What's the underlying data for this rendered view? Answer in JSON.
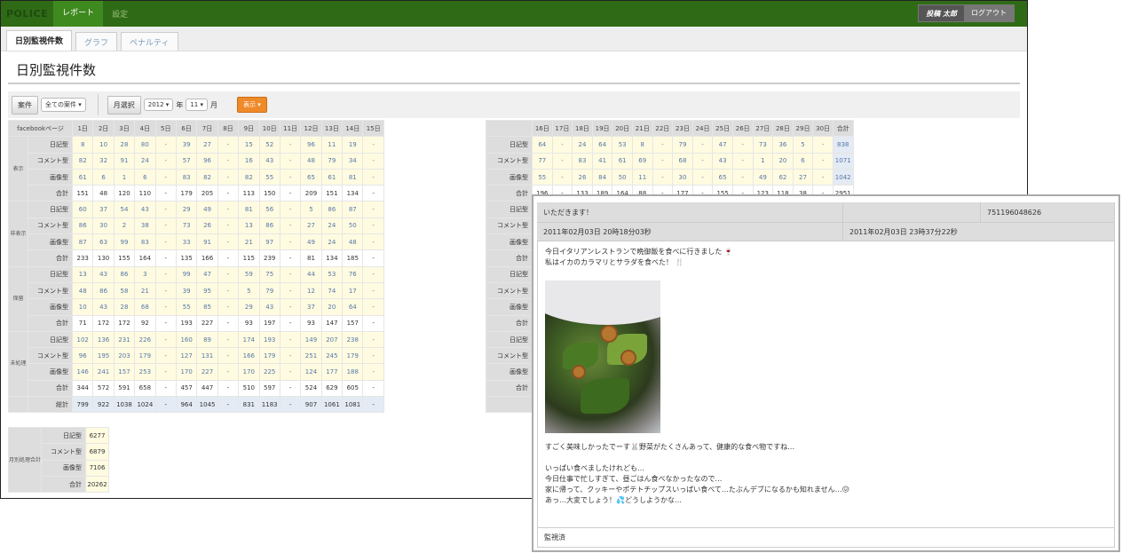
{
  "topbar": {
    "logo": "POLICE",
    "nav_report": "レポート",
    "nav_settings": "設定",
    "user_name": "投稿 太郎",
    "logout": "ログアウト"
  },
  "tabs": [
    "日別監視件数",
    "グラフ",
    "ペナルティ"
  ],
  "page_title": "日別監視件数",
  "filters": {
    "case_button": "案件",
    "case_select": "全ての案件",
    "month_button": "月選択",
    "year_select": "2012",
    "year_label": "年",
    "month_select": "11",
    "month_label": "月",
    "go_button": "表示"
  },
  "table": {
    "corner_label": "facebookページ",
    "days_left": [
      "1日",
      "2日",
      "3日",
      "4日",
      "5日",
      "6日",
      "7日",
      "8日",
      "9日",
      "10日",
      "11日",
      "12日",
      "13日",
      "14日",
      "15日"
    ],
    "days_right": [
      "16日",
      "17日",
      "18日",
      "19日",
      "20日",
      "21日",
      "22日",
      "23日",
      "24日",
      "25日",
      "26日",
      "27日",
      "28日",
      "29日",
      "30日",
      "合計"
    ],
    "groups": [
      {
        "label": "表示",
        "rows": [
          {
            "label": "日記型",
            "left": [
              "8",
              "10",
              "28",
              "80",
              "-",
              "39",
              "27",
              "-",
              "15",
              "52",
              "-",
              "96",
              "11",
              "19",
              "-"
            ],
            "right": [
              "64",
              "-",
              "24",
              "64",
              "53",
              "8",
              "-",
              "79",
              "-",
              "47",
              "-",
              "73",
              "36",
              "5",
              "-",
              "838"
            ]
          },
          {
            "label": "コメント型",
            "left": [
              "82",
              "32",
              "91",
              "24",
              "-",
              "57",
              "96",
              "-",
              "16",
              "43",
              "-",
              "48",
              "79",
              "34",
              "-"
            ],
            "right": [
              "77",
              "-",
              "83",
              "41",
              "61",
              "69",
              "-",
              "68",
              "-",
              "43",
              "-",
              "1",
              "20",
              "6",
              "-",
              "1071"
            ]
          },
          {
            "label": "画像型",
            "left": [
              "61",
              "6",
              "1",
              "6",
              "-",
              "83",
              "82",
              "-",
              "82",
              "55",
              "-",
              "65",
              "61",
              "81",
              "-"
            ],
            "right": [
              "55",
              "-",
              "26",
              "84",
              "50",
              "11",
              "-",
              "30",
              "-",
              "65",
              "-",
              "49",
              "62",
              "27",
              "-",
              "1042"
            ]
          },
          {
            "label": "合計",
            "left": [
              "151",
              "48",
              "120",
              "110",
              "-",
              "179",
              "205",
              "-",
              "113",
              "150",
              "-",
              "209",
              "151",
              "134",
              "-"
            ],
            "right": [
              "196",
              "-",
              "133",
              "189",
              "164",
              "88",
              "-",
              "177",
              "-",
              "155",
              "-",
              "123",
              "118",
              "38",
              "-",
              "2951"
            ]
          }
        ]
      },
      {
        "label": "非表示",
        "rows": [
          {
            "label": "日記型",
            "left": [
              "60",
              "37",
              "54",
              "43",
              "-",
              "29",
              "49",
              "-",
              "81",
              "56",
              "-",
              "5",
              "86",
              "87",
              "-"
            ]
          },
          {
            "label": "コメント型",
            "left": [
              "86",
              "30",
              "2",
              "38",
              "-",
              "73",
              "26",
              "-",
              "13",
              "86",
              "-",
              "27",
              "24",
              "50",
              "-"
            ]
          },
          {
            "label": "画像型",
            "left": [
              "87",
              "63",
              "99",
              "83",
              "-",
              "33",
              "91",
              "-",
              "21",
              "97",
              "-",
              "49",
              "24",
              "48",
              "-"
            ]
          },
          {
            "label": "合計",
            "left": [
              "233",
              "130",
              "155",
              "164",
              "-",
              "135",
              "166",
              "-",
              "115",
              "239",
              "-",
              "81",
              "134",
              "185",
              "-"
            ]
          }
        ]
      },
      {
        "label": "保留",
        "rows": [
          {
            "label": "日記型",
            "left": [
              "13",
              "43",
              "86",
              "3",
              "-",
              "99",
              "47",
              "-",
              "59",
              "75",
              "-",
              "44",
              "53",
              "76",
              "-"
            ]
          },
          {
            "label": "コメント型",
            "left": [
              "48",
              "86",
              "58",
              "21",
              "-",
              "39",
              "95",
              "-",
              "5",
              "79",
              "-",
              "12",
              "74",
              "17",
              "-"
            ]
          },
          {
            "label": "画像型",
            "left": [
              "10",
              "43",
              "28",
              "68",
              "-",
              "55",
              "85",
              "-",
              "29",
              "43",
              "-",
              "37",
              "20",
              "64",
              "-"
            ]
          },
          {
            "label": "合計",
            "left": [
              "71",
              "172",
              "172",
              "92",
              "-",
              "193",
              "227",
              "-",
              "93",
              "197",
              "-",
              "93",
              "147",
              "157",
              "-"
            ]
          }
        ]
      },
      {
        "label": "未処理",
        "rows": [
          {
            "label": "日記型",
            "left": [
              "102",
              "136",
              "231",
              "226",
              "-",
              "160",
              "89",
              "-",
              "174",
              "193",
              "-",
              "149",
              "207",
              "238",
              "-"
            ]
          },
          {
            "label": "コメント型",
            "left": [
              "96",
              "195",
              "203",
              "179",
              "-",
              "127",
              "131",
              "-",
              "166",
              "179",
              "-",
              "251",
              "245",
              "179",
              "-"
            ]
          },
          {
            "label": "画像型",
            "left": [
              "146",
              "241",
              "157",
              "253",
              "-",
              "170",
              "227",
              "-",
              "170",
              "225",
              "-",
              "124",
              "177",
              "188",
              "-"
            ]
          },
          {
            "label": "合計",
            "left": [
              "344",
              "572",
              "591",
              "658",
              "-",
              "457",
              "447",
              "-",
              "510",
              "597",
              "-",
              "524",
              "629",
              "605",
              "-"
            ]
          }
        ]
      }
    ],
    "grand_total": {
      "label": "総計",
      "left": [
        "799",
        "922",
        "1038",
        "1024",
        "-",
        "964",
        "1045",
        "-",
        "831",
        "1183",
        "-",
        "907",
        "1061",
        "1081",
        "-"
      ]
    }
  },
  "monthly": {
    "label": "月別処理合計",
    "rows": [
      {
        "label": "日記型",
        "value": "6277"
      },
      {
        "label": "コメント型",
        "value": "6879"
      },
      {
        "label": "画像型",
        "value": "7106"
      },
      {
        "label": "合計",
        "value": "20262"
      }
    ]
  },
  "popup": {
    "title": "いただきます！",
    "id": "751196048626",
    "posted_at": "2011年02月03日 20時18分03秒",
    "checked_at": "2011年02月03日 23時37分22秒",
    "line1": "今日イタリアンレストランで晩御飯を食べに行きました",
    "line2": "私はイカのカラマリとサラダを食べた！",
    "line3": "すごく美味しかったでーす",
    "line3b": "野菜がたくさんあって、健康的な食べ物ですね…",
    "line4": "いっぱい食べましたけれども…",
    "line5": "今日仕事で忙しすぎて、昼ごはん食べなかったなので…",
    "line6": "家に帰って、クッキーやポテトチップスいっぱい食べて…たぶんデブになるかも知れません…",
    "line7": "あっ…大変でしょう！",
    "line7b": "どうしようかな…",
    "status": "監視済"
  }
}
